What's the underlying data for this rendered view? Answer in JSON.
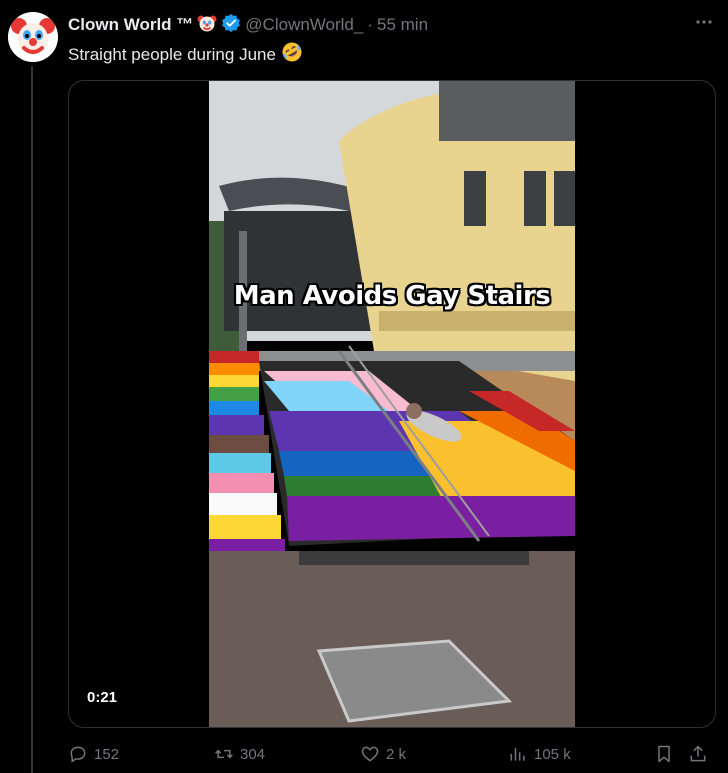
{
  "author": {
    "name": "Clown World ™",
    "handle": "@ClownWorld_",
    "separator": "·",
    "time": "55 min",
    "verified": true,
    "name_emoji": "clown-face"
  },
  "tweet": {
    "text": "Straight people during June",
    "emoji": "rolling-on-floor-laughing"
  },
  "media": {
    "overlay_caption": "Man Avoids Gay Stairs",
    "duration": "0:21"
  },
  "actions": {
    "replies": "152",
    "reposts": "304",
    "likes": "2 k",
    "views": "105 k"
  },
  "colors": {
    "background": "#000000",
    "text": "#e7e9ea",
    "muted": "#71767b",
    "verified": "#1d9bf0"
  }
}
